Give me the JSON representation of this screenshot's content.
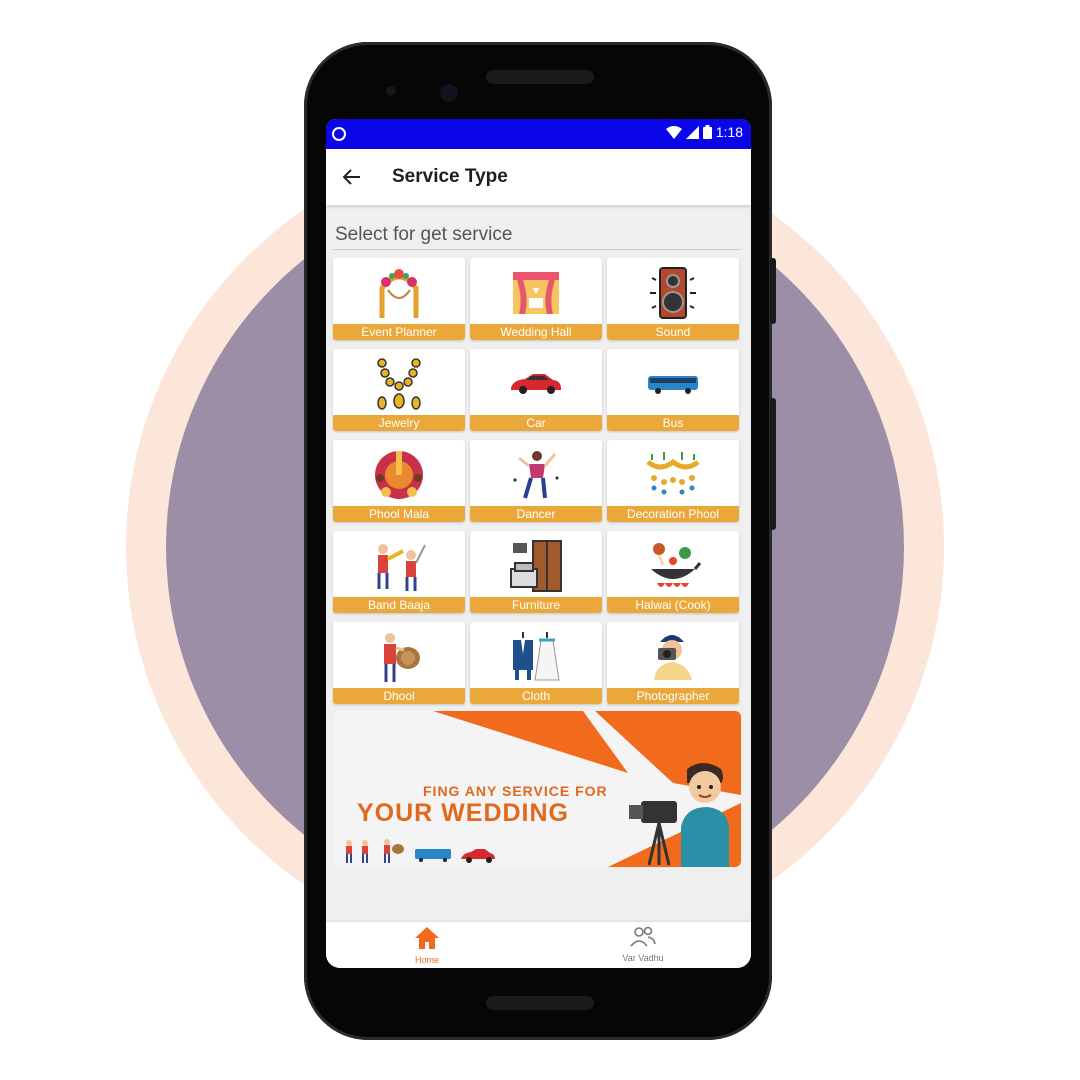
{
  "status_bar": {
    "time": "1:18"
  },
  "app_bar": {
    "title": "Service Type",
    "back_icon": "arrow-left-icon"
  },
  "section": {
    "heading": "Select for get service"
  },
  "services": [
    {
      "label": "Event Planner",
      "icon": "floral-arch-icon"
    },
    {
      "label": "Wedding Hall",
      "icon": "wedding-hall-icon"
    },
    {
      "label": "Sound",
      "icon": "speaker-icon"
    },
    {
      "label": "Jewelry",
      "icon": "necklace-icon"
    },
    {
      "label": "Car",
      "icon": "car-icon"
    },
    {
      "label": "Bus",
      "icon": "bus-icon"
    },
    {
      "label": "Phool Mala",
      "icon": "flower-garland-icon"
    },
    {
      "label": "Dancer",
      "icon": "dancer-icon"
    },
    {
      "label": "Decoration Phool",
      "icon": "flower-decoration-icon"
    },
    {
      "label": "Band Baaja",
      "icon": "band-players-icon"
    },
    {
      "label": "Furniture",
      "icon": "furniture-icon"
    },
    {
      "label": "Halwai (Cook)",
      "icon": "cooking-pan-icon"
    },
    {
      "label": "Dhool",
      "icon": "dhol-drummer-icon"
    },
    {
      "label": "Cloth",
      "icon": "wedding-clothes-icon"
    },
    {
      "label": "Photographer",
      "icon": "photographer-icon"
    }
  ],
  "banner": {
    "line1": "FING ANY SERVICE FOR",
    "line2": "YOUR WEDDING"
  },
  "bottom_nav": [
    {
      "label": "Home",
      "icon": "home-icon",
      "active": true
    },
    {
      "label": "Var Vadhu",
      "icon": "people-icon",
      "active": false
    }
  ],
  "colors": {
    "status_bar": "#0a06e8",
    "tile_label": "#eaa83a",
    "accent": "#f26a1b",
    "background_circle": "#9c8ea6"
  }
}
